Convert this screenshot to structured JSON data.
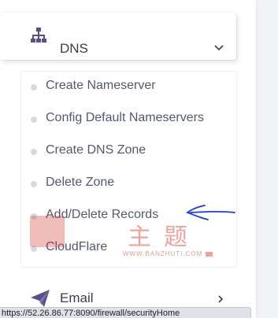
{
  "sidebar": {
    "dns": {
      "label": "DNS",
      "icon": "sitemap-icon",
      "expanded": true,
      "submenu": [
        {
          "label": "Create Nameserver"
        },
        {
          "label": "Config Default Nameservers"
        },
        {
          "label": "Create DNS Zone"
        },
        {
          "label": "Delete Zone"
        },
        {
          "label": "Add/Delete Records"
        },
        {
          "label": "CloudFlare"
        }
      ]
    },
    "email": {
      "label": "Email",
      "icon": "paper-plane-icon"
    }
  },
  "status_bar": {
    "url": "https://52.26.86.77:8090/firewall/securityHome"
  },
  "watermark": {
    "chars": "主题",
    "domain": "WWW.BANZHUTI.COM"
  },
  "colors": {
    "menu_text": "#3a3d52",
    "icon_accent": "#5b4f8a",
    "annotation_arrow": "#1d3fd6",
    "watermark_red": "#e2574c"
  }
}
